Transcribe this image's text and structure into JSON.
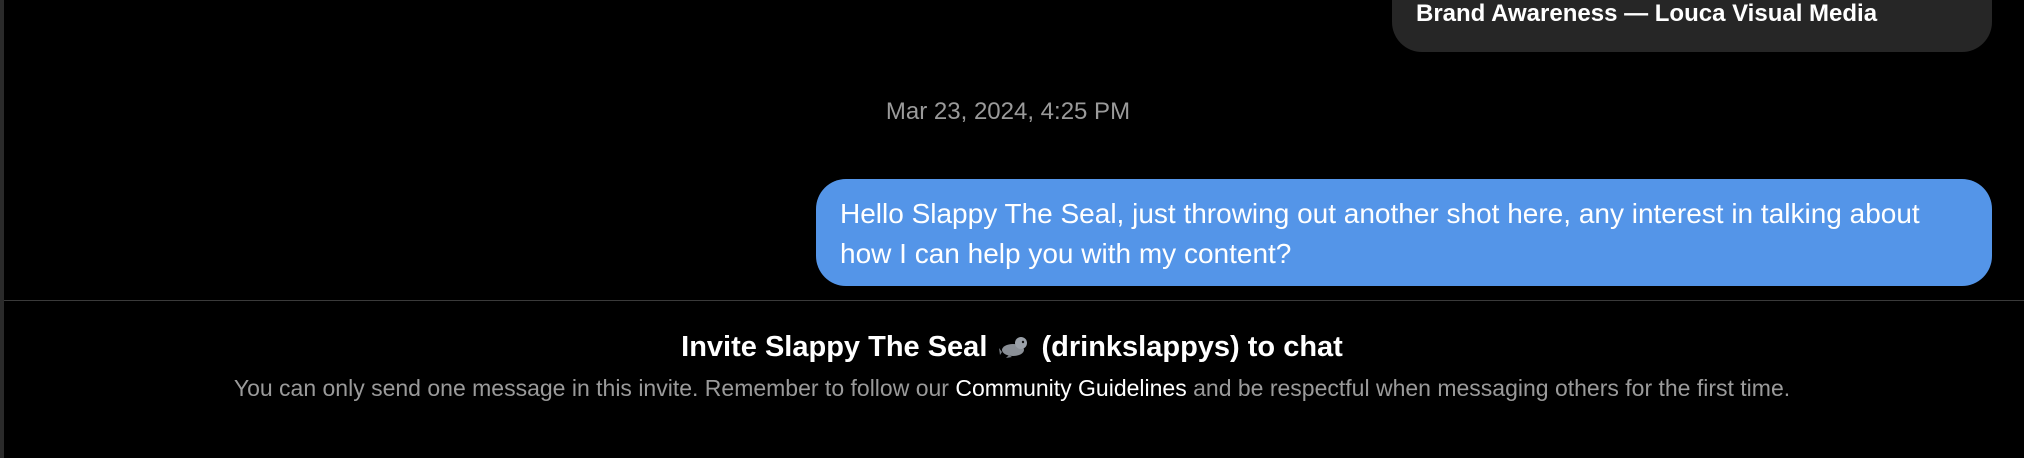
{
  "previous_message": {
    "text": "Brand Awareness — Louca Visual Media"
  },
  "thread": {
    "timestamp": "Mar 23, 2024, 4:25 PM",
    "sent_message": {
      "text": "Hello Slappy The Seal, just throwing out another shot here, any interest in talking about how I can help you with my content?",
      "bubble_color": "#5495e8"
    }
  },
  "invite": {
    "title_prefix": "Invite Slappy The Seal",
    "title_suffix": "(drinkslappys) to chat",
    "icon": "seal-icon",
    "note_before": "You can only send one message in this invite. Remember to follow our",
    "guidelines_link": "Community Guidelines",
    "note_after": "and be respectful when messaging others for the first time."
  },
  "colors": {
    "background": "#000000",
    "received_bubble": "#262626",
    "muted_text": "#9a9a9a"
  }
}
